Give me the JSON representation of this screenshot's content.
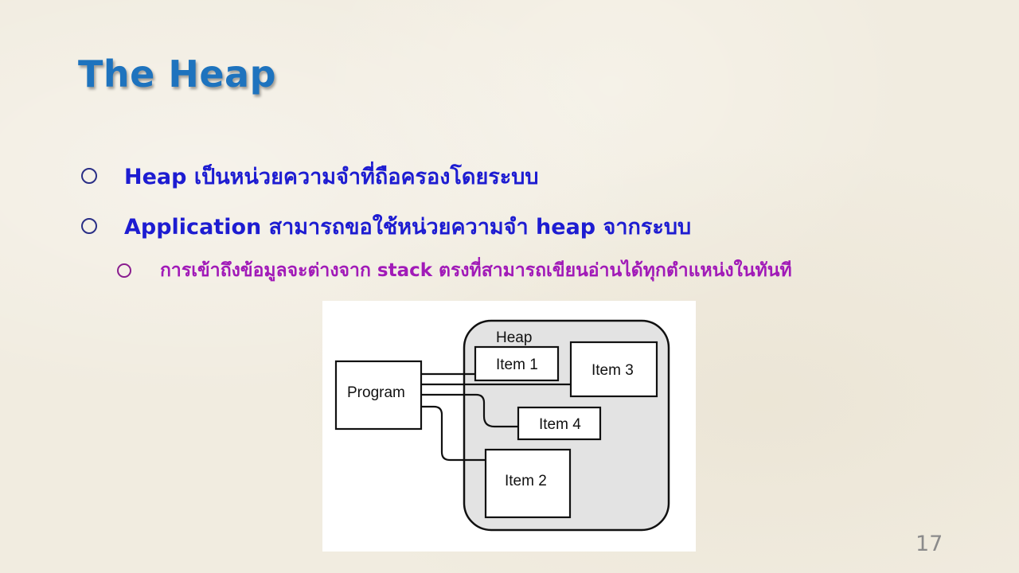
{
  "slide": {
    "title": "The Heap",
    "page_number": "17"
  },
  "bullets": [
    {
      "text": "Heap เป็นหน่วยความจำที่ถือครองโดยระบบ"
    },
    {
      "text": "Application สามารถขอใช้หน่วยความจำ heap จากระบบ"
    },
    {
      "text": "การเข้าถึงข้อมูลจะต่างจาก stack ตรงที่สามารถเขียนอ่านได้ทุกตำแหน่งในทันที"
    }
  ],
  "diagram": {
    "heap_label": "Heap",
    "program_label": "Program",
    "items": [
      {
        "label": "Item 1"
      },
      {
        "label": "Item 3"
      },
      {
        "label": "Item 4"
      },
      {
        "label": "Item 2"
      }
    ]
  },
  "colors": {
    "title": "#1e73be",
    "bullet_level1": "#1d1cd1",
    "bullet_level2": "#a11ab8",
    "page_number": "#8b8b8b",
    "heap_fill": "#e3e3e3"
  }
}
